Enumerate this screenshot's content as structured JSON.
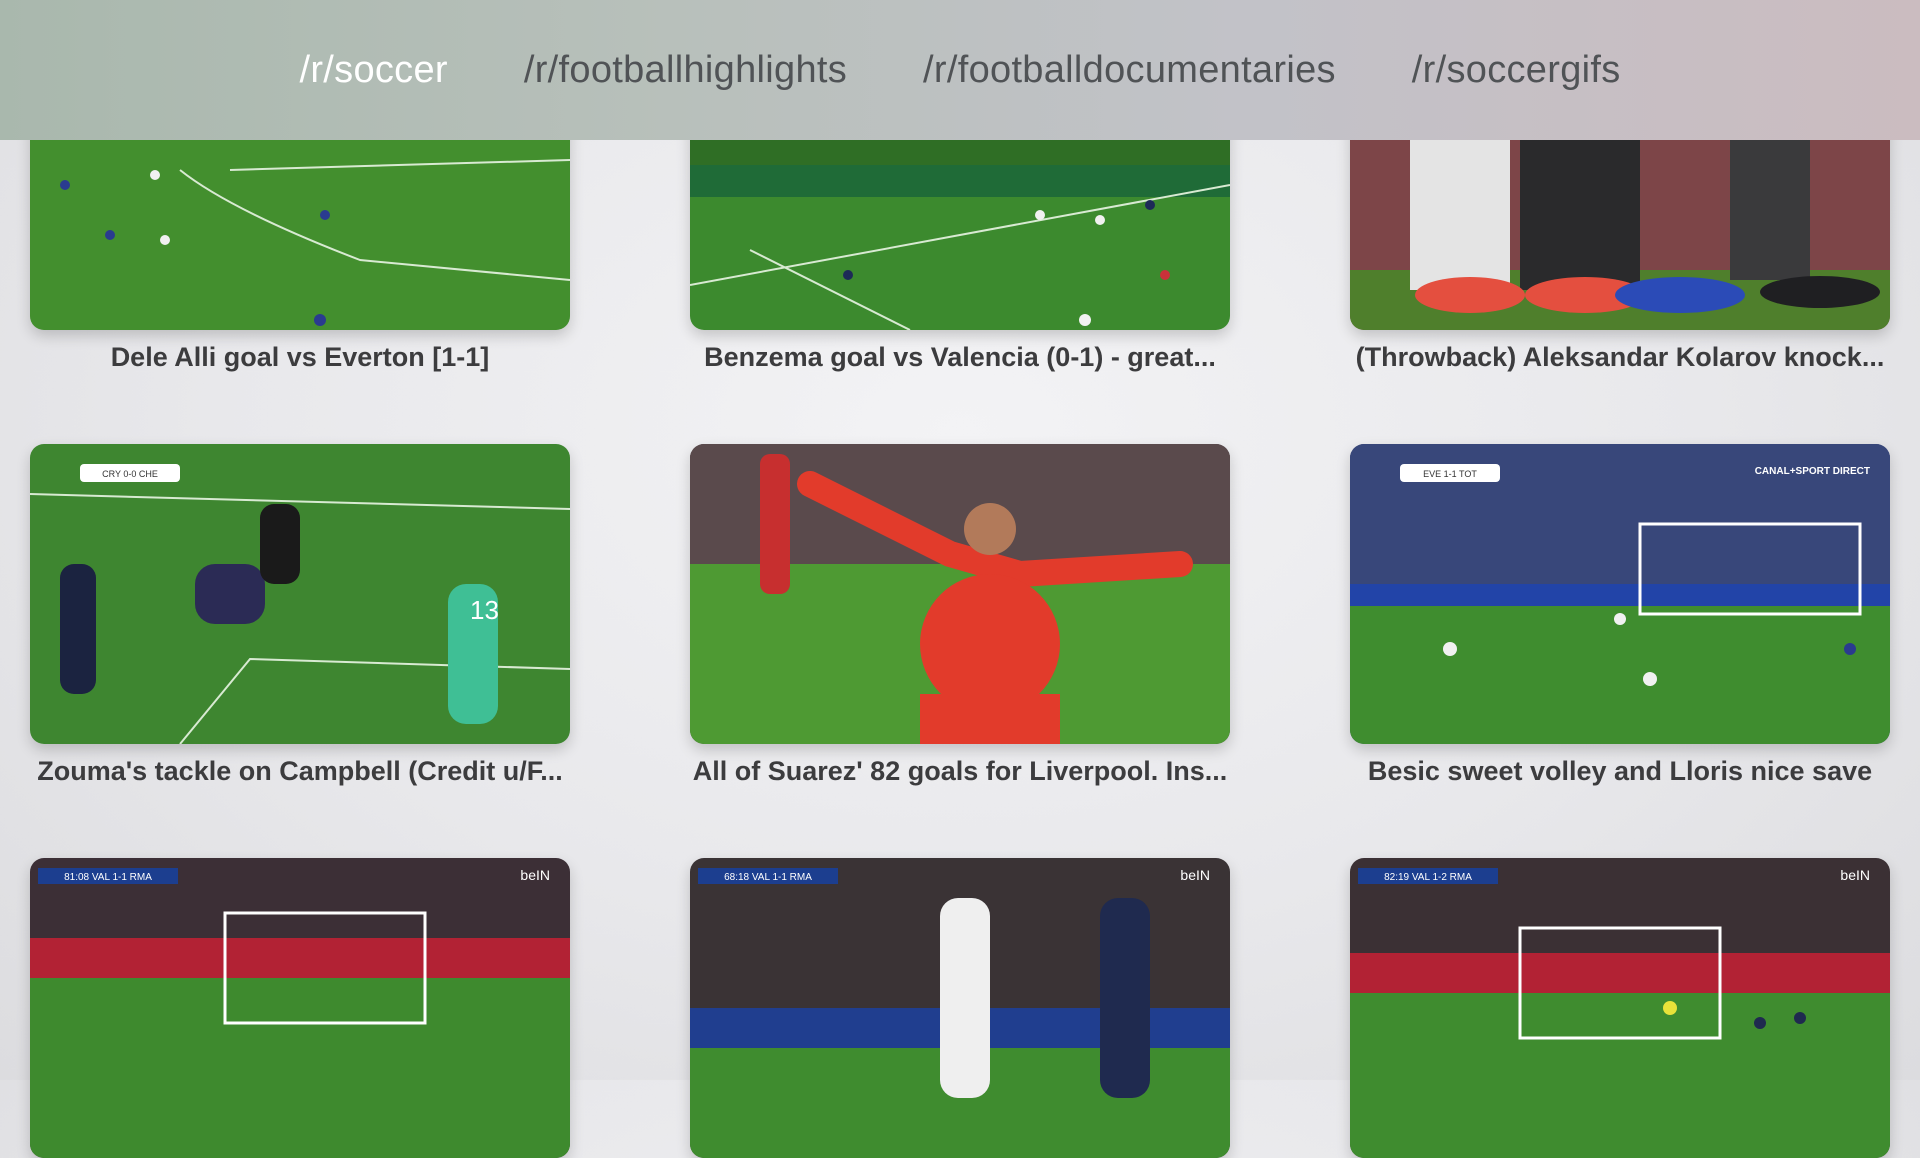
{
  "nav": {
    "tabs": [
      {
        "label": "/r/soccer",
        "active": true
      },
      {
        "label": "/r/footballhighlights",
        "active": false
      },
      {
        "label": "/r/footballdocumentaries",
        "active": false
      },
      {
        "label": "/r/soccergifs",
        "active": false
      }
    ]
  },
  "videos": [
    {
      "title": "Dele Alli goal vs Everton [1-1]"
    },
    {
      "title": "Benzema goal vs Valencia (0-1) - great..."
    },
    {
      "title": "(Throwback) Aleksandar Kolarov knock..."
    },
    {
      "title": "Zouma's tackle on Campbell (Credit u/F..."
    },
    {
      "title": "All of Suarez' 82 goals for Liverpool. Ins..."
    },
    {
      "title": "Besic sweet volley and Lloris nice save"
    },
    {
      "title": ""
    },
    {
      "title": ""
    },
    {
      "title": ""
    }
  ],
  "overlays": {
    "scoreboard_a": "CRY 0-0 CHE",
    "scoreboard_b": "EVE 1-1 TOT",
    "broadcaster": "CANAL+SPORT DIRECT",
    "score_c": "81:08  VAL 1-1 RMA",
    "score_d": "68:18  VAL 1-1 RMA",
    "score_e": "82:19  VAL 1-2 RMA",
    "bein": "beIN"
  },
  "colors": {
    "pitch": "#3f8a2c",
    "active_tab": "#ffffff",
    "inactive_tab": "#505356"
  }
}
